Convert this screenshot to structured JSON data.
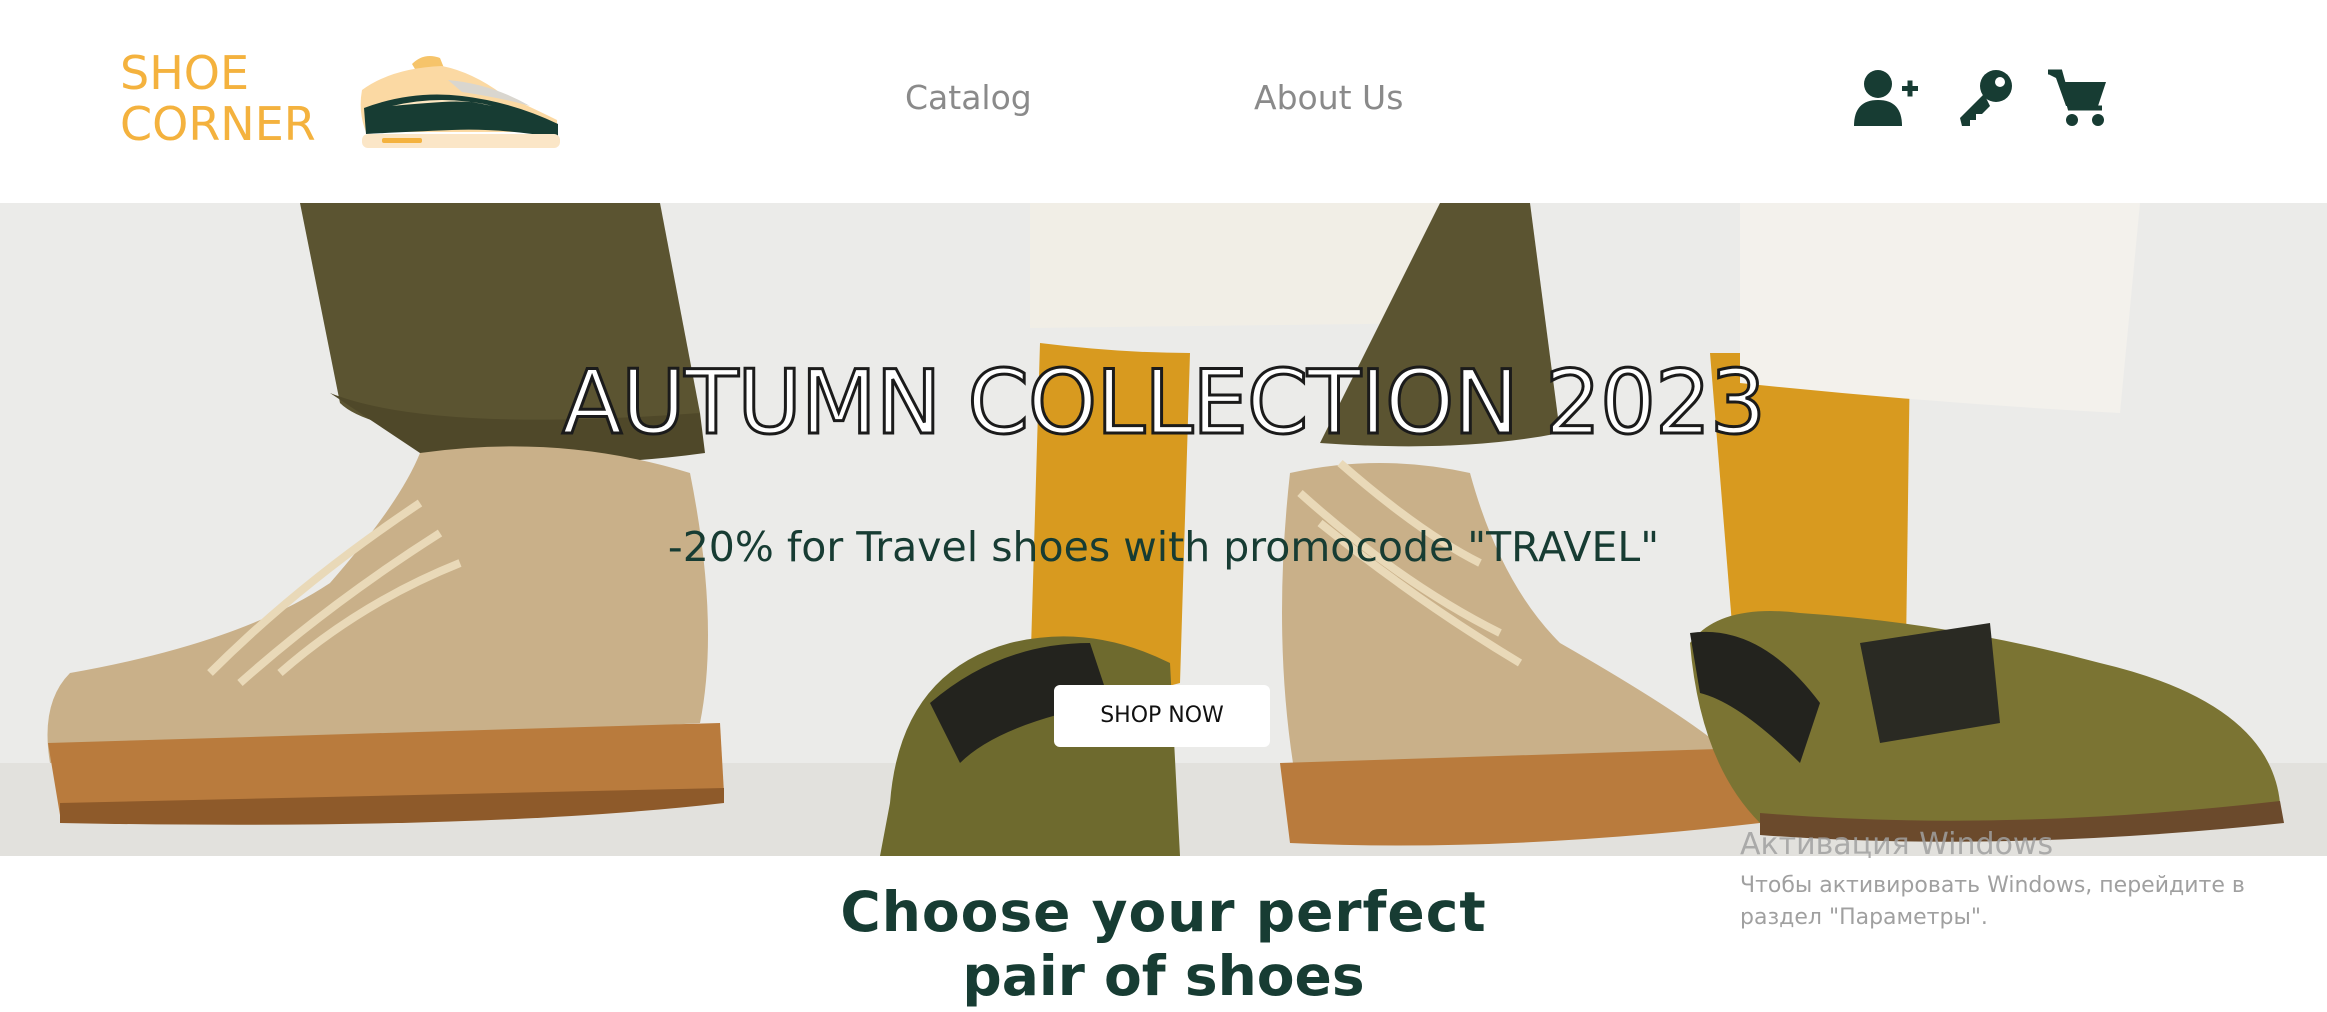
{
  "header": {
    "logo_line1": "SHOE",
    "logo_line2": "CORNER",
    "nav": {
      "catalog": "Catalog",
      "about": "About Us"
    },
    "icons": [
      "user-plus-icon",
      "key-icon",
      "cart-icon"
    ]
  },
  "hero": {
    "title": "AUTUMN COLLECTION 2023",
    "subtitle": "-20% for Travel shoes with promocode \"TRAVEL\"",
    "button": "SHOP NOW"
  },
  "section": {
    "title_line1": "Choose your perfect",
    "title_line2": "pair of shoes"
  },
  "windows_activation": {
    "title": "Активация Windows",
    "text": "Чтобы активировать Windows, перейдите в раздел \"Параметры\"."
  },
  "colors": {
    "brand_orange": "#f4b23e",
    "dark_green": "#173c33",
    "nav_grey": "#8a8a8a"
  }
}
